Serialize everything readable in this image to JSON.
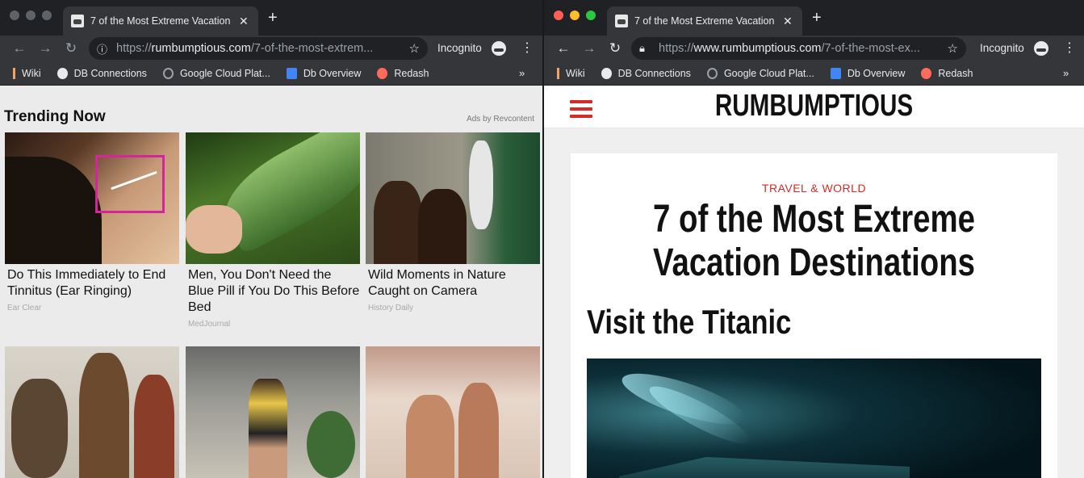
{
  "left_window": {
    "tab_title": "7 of the Most Extreme Vacation",
    "url_host": "rumbumptious.com",
    "url_prefix": "https://",
    "url_path": "/7-of-the-most-extrem...",
    "incognito_label": "Incognito",
    "bookmarks": [
      "Wiki",
      "DB Connections",
      "Google Cloud Plat...",
      "Db Overview",
      "Redash"
    ],
    "bookmarks_more": "»",
    "trending_title": "Trending Now",
    "ads_by": "Ads by Revcontent",
    "cards": [
      {
        "headline": "Do This Immediately to End Tinnitus (Ear Ringing)",
        "source": "Ear Clear"
      },
      {
        "headline": "Men, You Don't Need the Blue Pill if You Do This Before Bed",
        "source": "MedJournal"
      },
      {
        "headline": "Wild Moments in Nature Caught on Camera",
        "source": "History Daily"
      }
    ]
  },
  "right_window": {
    "tab_title": "7 of the Most Extreme Vacation",
    "url_prefix": "https://",
    "url_host": "www.rumbumptious.com",
    "url_path": "/7-of-the-most-ex...",
    "incognito_label": "Incognito",
    "bookmarks": [
      "Wiki",
      "DB Connections",
      "Google Cloud Plat...",
      "Db Overview",
      "Redash"
    ],
    "bookmarks_more": "»",
    "site_logo": "RUMBUMPTIOUS",
    "category": "TRAVEL & WORLD",
    "article_title": "7 of the Most Extreme Vacation Destinations",
    "section_heading": "Visit the Titanic"
  },
  "colors": {
    "chrome_dark": "#202124",
    "chrome_toolbar": "#35363a",
    "brand_red": "#d62b26",
    "traffic_red": "#ff5f57",
    "traffic_yellow": "#febc2e",
    "traffic_green": "#28c840"
  },
  "icons": {
    "back": "arrow-left-icon",
    "forward": "arrow-right-icon",
    "reload": "reload-icon",
    "info": "info-icon",
    "lock": "lock-icon",
    "star": "star-icon",
    "incognito": "incognito-icon",
    "menu": "kebab-menu-icon",
    "hamburger": "hamburger-menu-icon"
  }
}
